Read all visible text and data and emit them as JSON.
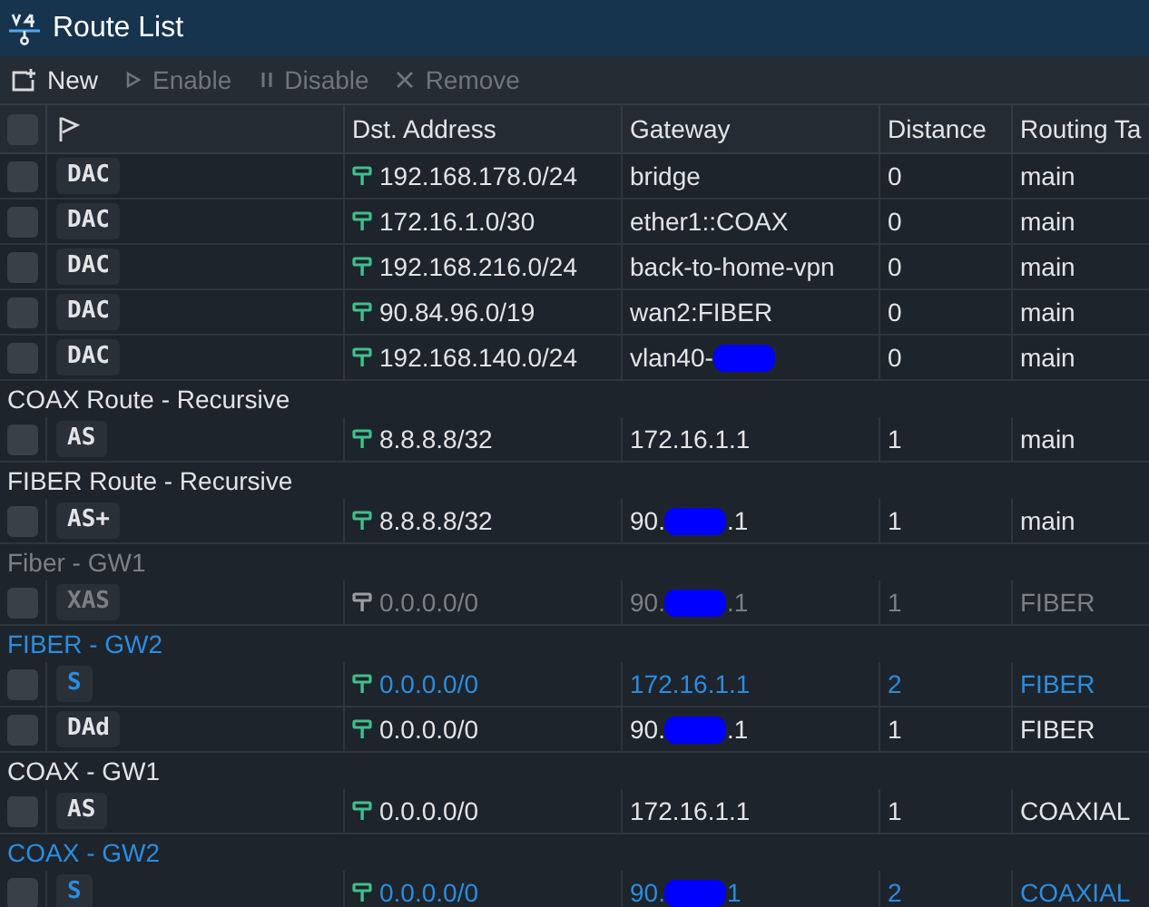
{
  "window": {
    "title": "Route List"
  },
  "toolbar": [
    {
      "label": "New",
      "kind": "new",
      "disabled": false
    },
    {
      "label": "Enable",
      "kind": "enable",
      "disabled": true
    },
    {
      "label": "Disable",
      "kind": "disable",
      "disabled": true
    },
    {
      "label": "Remove",
      "kind": "remove",
      "disabled": true
    }
  ],
  "table": {
    "select_all_checked": false,
    "columns": [
      "Dst. Address",
      "Gateway",
      "Distance",
      "Routing Ta"
    ],
    "rows": [
      {
        "flags": "DAC",
        "dst": "192.168.178.0/24",
        "gateway": "bridge",
        "distance": "0",
        "table": "main",
        "disabled": false,
        "inactive": false,
        "checked": false
      },
      {
        "flags": "DAC",
        "dst": "172.16.1.0/30",
        "gateway": "ether1::COAX",
        "distance": "0",
        "table": "main",
        "disabled": false,
        "inactive": false,
        "checked": false
      },
      {
        "flags": "DAC",
        "dst": "192.168.216.0/24",
        "gateway": "back-to-home-vpn",
        "distance": "0",
        "table": "main",
        "disabled": false,
        "inactive": false,
        "checked": false
      },
      {
        "flags": "DAC",
        "dst": "90.84.96.0/19",
        "gateway": "wan2:FIBER",
        "distance": "0",
        "table": "main",
        "disabled": false,
        "inactive": false,
        "checked": false
      },
      {
        "flags": "DAC",
        "dst": "192.168.140.0/24",
        "gateway": "vlan40-",
        "gateway_redacted": true,
        "distance": "0",
        "table": "main",
        "disabled": false,
        "inactive": false,
        "checked": false
      },
      {
        "comment": "COAX Route - Recursive",
        "flags": "AS",
        "dst": "8.8.8.8/32",
        "gateway": "172.16.1.1",
        "distance": "1",
        "table": "main",
        "disabled": false,
        "inactive": false,
        "checked": false
      },
      {
        "comment": "FIBER Route - Recursive",
        "flags": "AS+",
        "dst": "8.8.8.8/32",
        "gateway": "90.",
        "gateway_redacted": true,
        "gateway_tail": ".1",
        "distance": "1",
        "table": "main",
        "disabled": false,
        "inactive": false,
        "checked": false
      },
      {
        "comment": "Fiber - GW1",
        "flags": "XAS",
        "dst": "0.0.0.0/0",
        "gateway": "90.",
        "gateway_redacted": true,
        "gateway_tail": ".1",
        "distance": "1",
        "table": "FIBER",
        "disabled": true,
        "inactive": false,
        "checked": false
      },
      {
        "comment": "FIBER - GW2",
        "flags": "S",
        "dst": "0.0.0.0/0",
        "gateway": "172.16.1.1",
        "distance": "2",
        "table": "FIBER",
        "disabled": false,
        "inactive": true,
        "checked": false
      },
      {
        "flags": "DAd",
        "dst": "0.0.0.0/0",
        "gateway": "90.",
        "gateway_redacted": true,
        "gateway_tail": ".1",
        "distance": "1",
        "table": "FIBER",
        "disabled": false,
        "inactive": false,
        "checked": false
      },
      {
        "comment": "COAX - GW1",
        "flags": "AS",
        "dst": "0.0.0.0/0",
        "gateway": "172.16.1.1",
        "distance": "1",
        "table": "COAXIAL",
        "disabled": false,
        "inactive": false,
        "checked": false
      },
      {
        "comment": "COAX - GW2",
        "flags": "S",
        "dst": "0.0.0.0/0",
        "gateway": "90.",
        "gateway_redacted": true,
        "gateway_tail": "1",
        "distance": "2",
        "table": "COAXIAL",
        "disabled": false,
        "inactive": true,
        "checked": false
      }
    ]
  }
}
